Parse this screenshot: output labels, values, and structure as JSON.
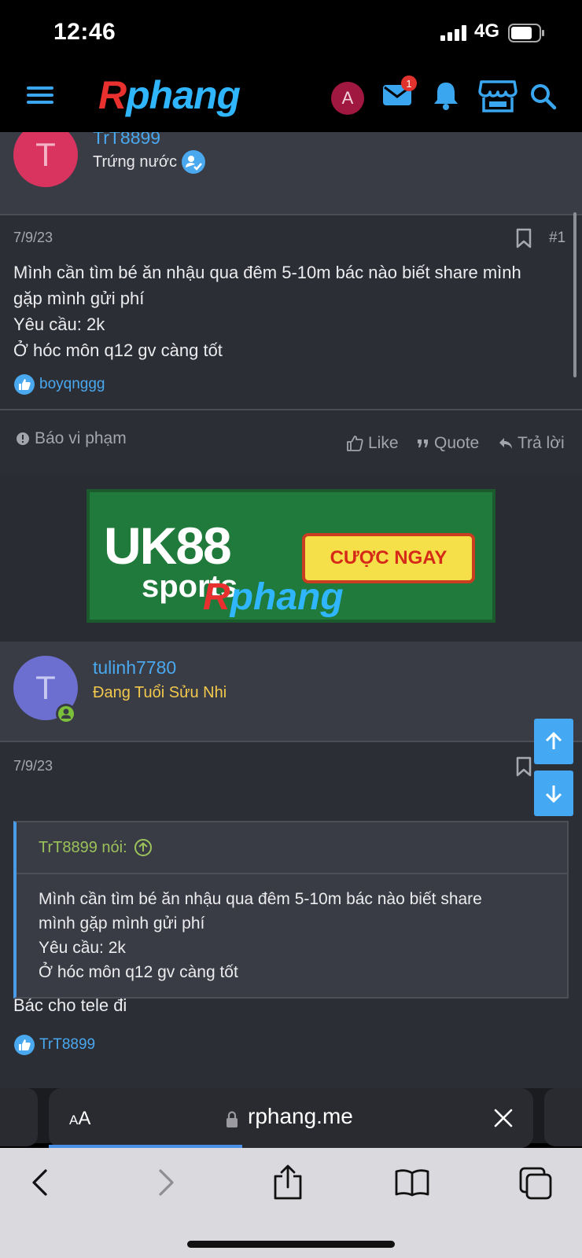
{
  "status_bar": {
    "time": "12:46",
    "network": "4G"
  },
  "header": {
    "logo": {
      "r": "R",
      "rest": "phang"
    },
    "avatar_letter": "A",
    "notification_count": "1"
  },
  "first_user": {
    "initial": "T",
    "username": "TrT8899",
    "title": "Trứng nước"
  },
  "post1": {
    "date": "7/9/23",
    "number": "#1",
    "lines": [
      "Mình cần tìm bé ăn nhậu qua đêm 5-10m bác nào biết share mình",
      "gặp mình gửi phí",
      "Yêu cầu: 2k",
      "Ở hóc môn q12 gv càng tốt"
    ],
    "reaction_user": "boyqnggg",
    "report_label": "Báo vi phạm",
    "like_label": "Like",
    "quote_label": "Quote",
    "reply_label": "Trả lời"
  },
  "ad": {
    "brand_line1": "UK88",
    "brand_line2": "sports",
    "cta": "CƯỢC NGAY",
    "watermark": {
      "r": "R",
      "rest": "phang"
    }
  },
  "second_user": {
    "initial": "T",
    "username": "tulinh7780",
    "title": "Đang Tuổi Sửu Nhi"
  },
  "post2": {
    "date": "7/9/23",
    "quote_author": "TrT8899 nói:",
    "quote_lines": [
      "Mình cần tìm bé ăn nhậu qua đêm 5-10m bác nào biết share",
      "mình gặp mình gửi phí",
      "Yêu cầu: 2k",
      "Ở hóc môn q12 gv càng tốt"
    ],
    "message": "Bác cho tele đi",
    "reaction_user": "TrT8899"
  },
  "browser": {
    "text_size_small": "A",
    "text_size_large": "A",
    "url": "rphang.me"
  },
  "colors": {
    "accent_blue": "#4aa8ee",
    "avatar_pink": "#d8345f",
    "avatar_purple": "#6c6fd0",
    "title_yellow": "#f2c94c",
    "quote_green": "#9bc25a"
  }
}
